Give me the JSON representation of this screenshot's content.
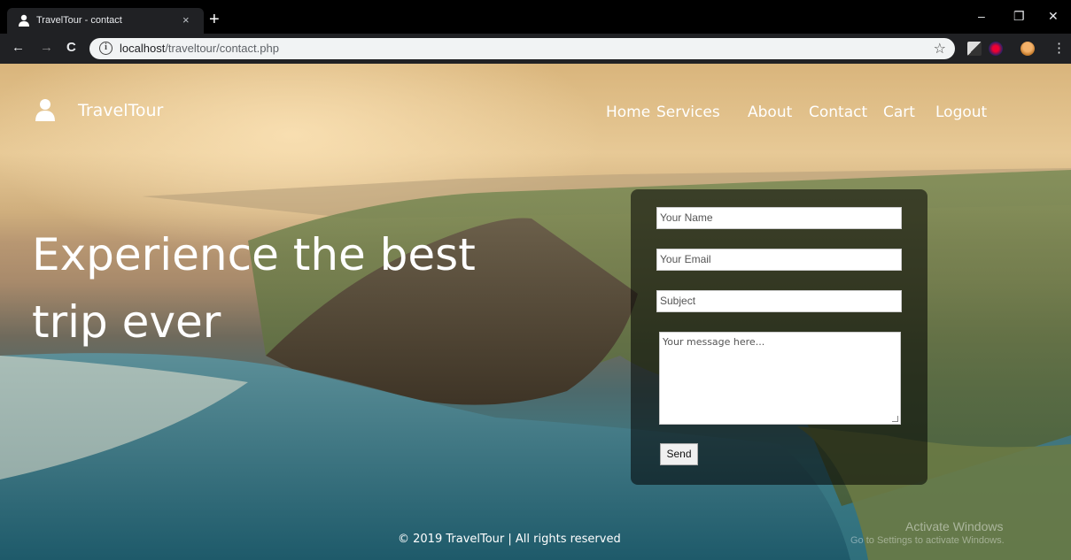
{
  "browser": {
    "tab_title": "TravelTour - contact",
    "tab_close": "×",
    "new_tab": "+",
    "url_host": "localhost",
    "url_path": "/traveltour/contact.php",
    "back": "←",
    "forward": "→",
    "reload": "C",
    "info": "i",
    "star": "☆",
    "minimize": "–",
    "restore": "❐",
    "close": "✕",
    "menu": "⋮"
  },
  "site": {
    "brand": "TravelTour",
    "nav": [
      "Home",
      "Services",
      "About",
      "Contact",
      "Cart",
      "Logout"
    ]
  },
  "hero": {
    "line1": "Experience the best",
    "line2": "trip ever"
  },
  "form": {
    "name_placeholder": "Your Name",
    "email_placeholder": "Your Email",
    "subject_placeholder": "Subject",
    "message_placeholder": "Your message here...",
    "send_label": "Send"
  },
  "footer": {
    "text": "© 2019 TravelTour | All rights reserved"
  },
  "watermark": {
    "line1": "Activate Windows",
    "line2": "Go to Settings to activate Windows."
  }
}
